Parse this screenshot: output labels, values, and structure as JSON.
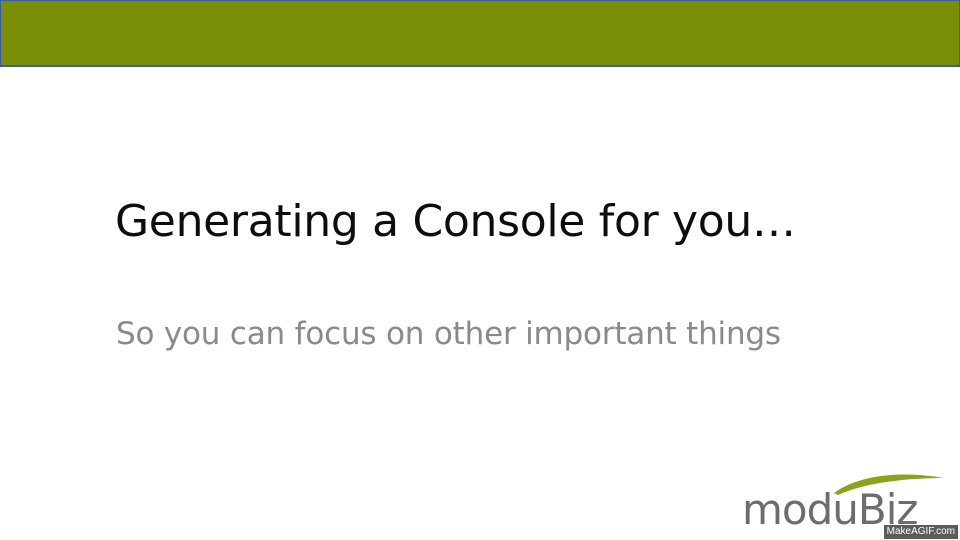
{
  "slide": {
    "title": "Generating a Console for you…",
    "subtitle": "So you can focus on other important things"
  },
  "logo": {
    "text": "moduBiz"
  },
  "watermark": {
    "text": "MakeAGIF.com"
  },
  "colors": {
    "top_bar": "#7a8f06",
    "top_bar_border": "#3a5ba8",
    "title": "#0d0d0d",
    "subtitle": "#8a8a8a",
    "logo_text": "#6d6d6d",
    "logo_swoosh": "#8aa31b"
  }
}
